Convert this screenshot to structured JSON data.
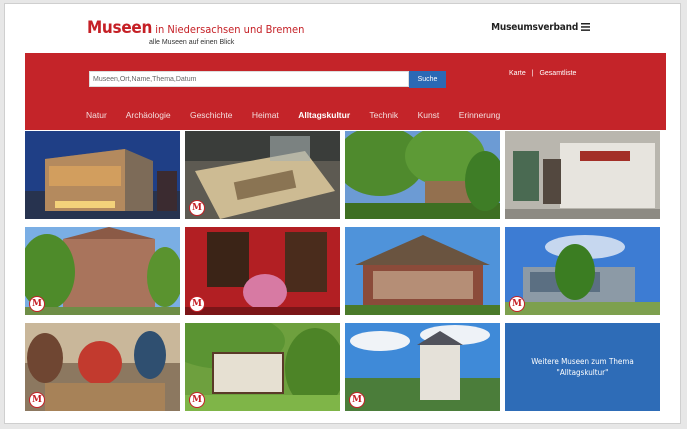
{
  "header": {
    "brand_bold": "Museen",
    "brand_rest": " in Niedersachsen und Bremen",
    "tagline": "alle Museen auf einen Blick",
    "verband_label": "Museumsverband",
    "menu_icon": "menu-icon"
  },
  "search": {
    "placeholder": "Museen,Ort,Name,Thema,Datum",
    "button_label": "Suche"
  },
  "top_links": [
    "Karte",
    "|",
    "Gesamtliste"
  ],
  "nav": [
    {
      "label": "Natur",
      "active": false
    },
    {
      "label": "Archäologie",
      "active": false
    },
    {
      "label": "Geschichte",
      "active": false
    },
    {
      "label": "Heimat",
      "active": false
    },
    {
      "label": "Alltagskultur",
      "active": true
    },
    {
      "label": "Technik",
      "active": false
    },
    {
      "label": "Kunst",
      "active": false
    },
    {
      "label": "Erinnerung",
      "active": false
    }
  ],
  "tiles": {
    "badge_label": "M",
    "cta_line1": "Weitere Museen zum Thema",
    "cta_line2": "\"Alltagskultur\""
  },
  "colors": {
    "brand_red": "#c52026",
    "search_blue": "#2b69b5",
    "cta_blue": "#2e6cb7"
  }
}
